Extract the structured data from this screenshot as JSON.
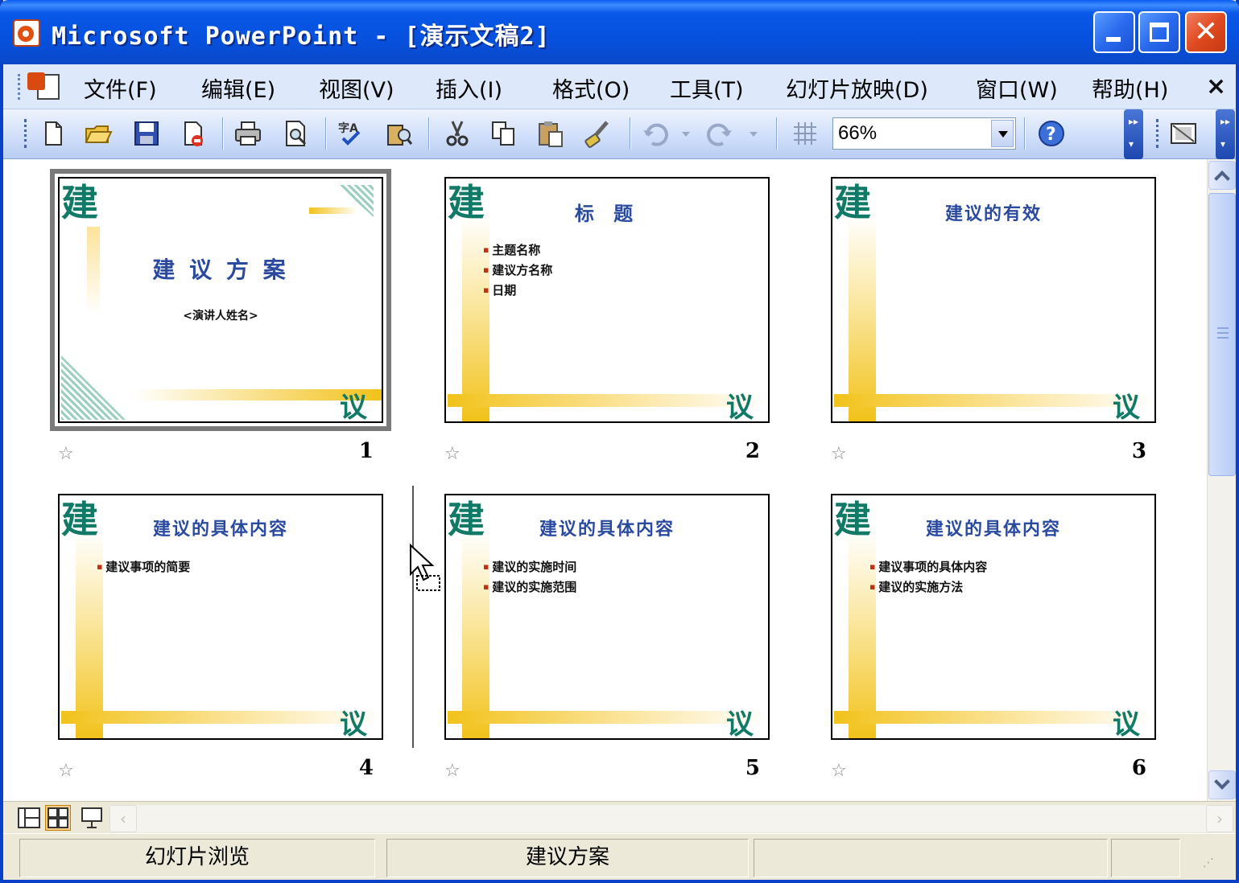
{
  "window": {
    "title": "Microsoft PowerPoint - [演示文稿2]"
  },
  "menu": {
    "items": [
      "文件(F)",
      "编辑(E)",
      "视图(V)",
      "插入(I)",
      "格式(O)",
      "工具(T)",
      "幻灯片放映(D)",
      "窗口(W)",
      "帮助(H)"
    ],
    "close_glyph": "×"
  },
  "toolbar": {
    "zoom_value": "66%",
    "icons": [
      "new-icon",
      "open-icon",
      "save-icon",
      "permission-icon",
      "print-icon",
      "print-preview-icon",
      "spelling-icon",
      "research-icon",
      "cut-icon",
      "copy-icon",
      "paste-icon",
      "format-painter-icon",
      "undo-icon",
      "redo-icon",
      "grid-icon",
      "help-icon",
      "color-grayscale-icon"
    ]
  },
  "slides": [
    {
      "number": "1",
      "title": "建 议 方 案",
      "subtitle": "<演讲人姓名>",
      "bullets": []
    },
    {
      "number": "2",
      "title": "标 题",
      "bullets": [
        "主题名称",
        "建议方名称",
        "日期"
      ]
    },
    {
      "number": "3",
      "title": "建议的有效",
      "bullets": []
    },
    {
      "number": "4",
      "title": "建议的具体内容",
      "bullets": [
        "建议事项的简要"
      ]
    },
    {
      "number": "5",
      "title": "建议的具体内容",
      "bullets": [
        "建议的实施时间",
        "建议的实施范围"
      ]
    },
    {
      "number": "6",
      "title": "建议的具体内容",
      "bullets": [
        "建议事项的具体内容",
        "建议的实施方法"
      ]
    }
  ],
  "slide_decor": {
    "corner_top": "建",
    "corner_bottom": "议"
  },
  "status": {
    "view_name": "幻灯片浏览",
    "design_name": "建议方案",
    "language": ""
  },
  "colors": {
    "title_bar": "#0a58e8",
    "slide_title": "#2a4aa0",
    "decor_green": "#107a66",
    "decor_gold": "#f2c21a"
  }
}
